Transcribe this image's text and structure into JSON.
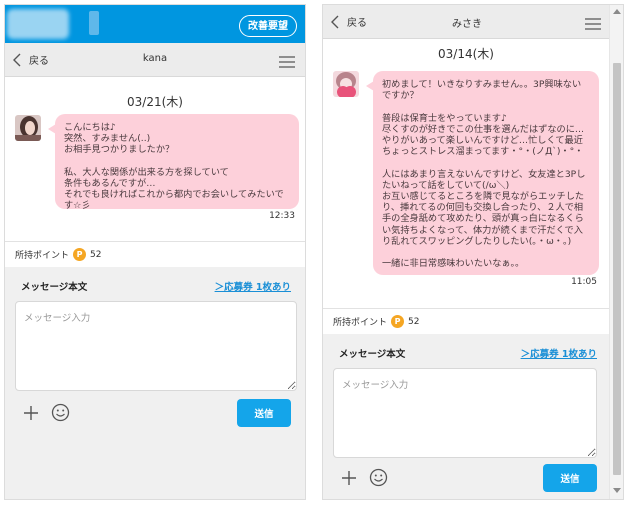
{
  "left": {
    "header": {
      "improve_label": "改善要望"
    },
    "nav": {
      "back_label": "戻る",
      "title": "kana"
    },
    "date": "03/21(木)",
    "message": {
      "text": "こんにちは♪\n突然、すみません(..)\nお相手見つかりましたか？\n\n私、大人な関係が出来る方を探していて\n条件もあるんですが…\nそれでも良ければこれから都内でお会いしてみたいです☆彡",
      "time": "12:33"
    },
    "points": {
      "label": "所持ポイント",
      "coin_symbol": "P",
      "value": "52"
    },
    "compose": {
      "label": "メッセージ本文",
      "coupon_link": "＞応募券 1枚あり",
      "placeholder": "メッセージ入力",
      "send_label": "送信"
    }
  },
  "right": {
    "nav": {
      "back_label": "戻る",
      "title": "みさき"
    },
    "date": "03/14(木)",
    "message": {
      "text": "初めまして！いきなりすみません。。3P興味ないですか？\n\n普段は保育士をやっています♪\n尽くすのが好きでこの仕事を選んだはずなのに…やりがいあって楽しいんですけど…忙しくて最近ちょっとストレス溜まってます・°・(ノД`)・°・\n\n人にはあまり言えないんですけど、女友達と3Pしたいねって話をしていて(/ω＼)\nお互い感じてるところを隣で見ながらエッチしたり、挿れてるの何回も交換し合ったり、２人で相手の全身舐めて攻めたり、頭が真っ白になるくらい気持ちよくなって、体力が続くまで汗だくで入り乱れてスワッピングしたりしたい(｡・ω・｡)\n\n一緒に非日常感味わいたいなぁ。。",
      "time": "11:05"
    },
    "points": {
      "label": "所持ポイント",
      "coin_symbol": "P",
      "value": "52"
    },
    "compose": {
      "label": "メッセージ本文",
      "coupon_link": "＞応募券 1枚あり",
      "placeholder": "メッセージ入力",
      "send_label": "送信"
    }
  },
  "colors": {
    "header_blue": "#0096e0",
    "bubble_pink": "#fdd0da",
    "send_blue": "#14a5ea",
    "coin_orange": "#f5a623",
    "link_blue": "#1a8fd6"
  },
  "icons": [
    "chevron-left-icon",
    "hamburger-menu-icon",
    "plus-icon",
    "emoji-icon",
    "coin-icon",
    "scroll-up-icon",
    "scroll-down-icon"
  ]
}
